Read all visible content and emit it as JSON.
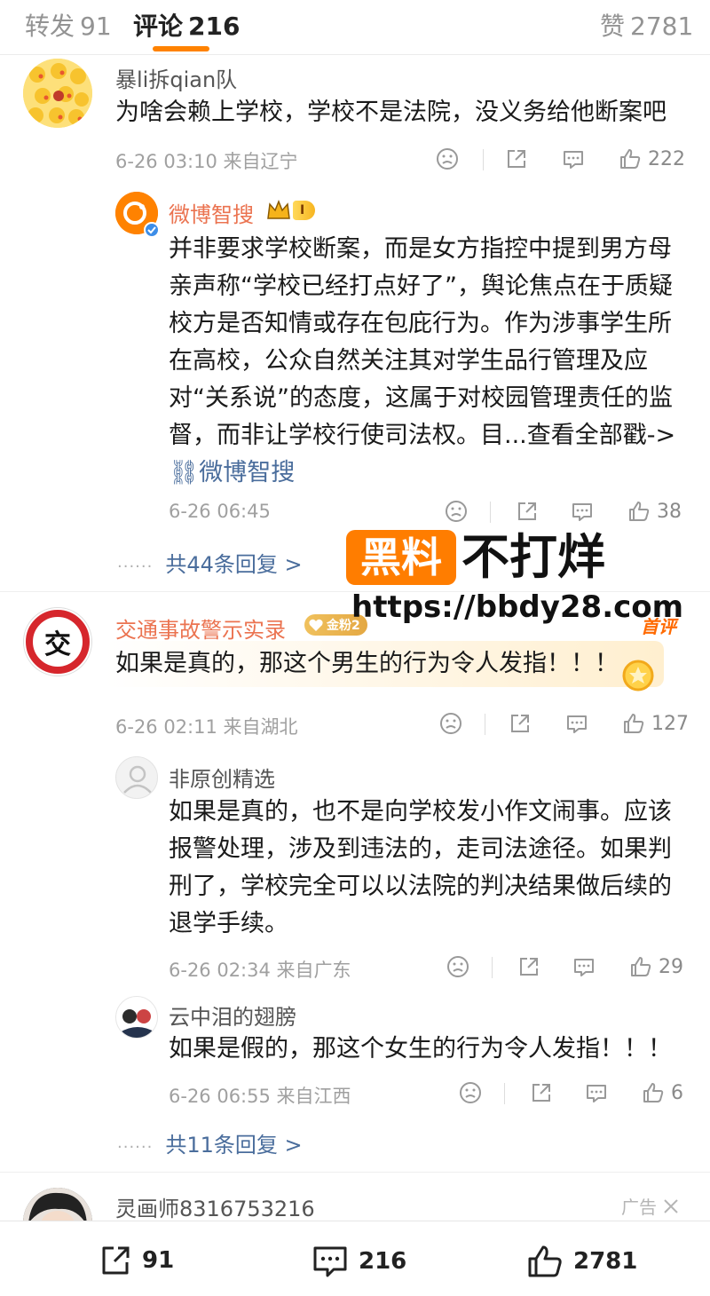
{
  "tabs": {
    "repost": {
      "label": "转发",
      "count": "91"
    },
    "comments": {
      "label": "评论",
      "count": "216"
    },
    "likes": {
      "label": "赞",
      "count": "2781"
    }
  },
  "comments": [
    {
      "user": "暴li拆qian队",
      "text": "为啥会赖上学校，学校不是法院，没义务给他断案吧",
      "meta": "6-26 03:10 来自辽宁",
      "likes": "222",
      "replies": [
        {
          "user": "微博智搜",
          "badge": "I",
          "text": "并非要求学校断案，而是女方指控中提到男方母亲声称“学校已经打点好了”，舆论焦点在于质疑校方是否知情或存在包庇行为。作为涉事学生所在高校，公众自然关注其对学生品行管理及应对“关系说”的态度，这属于对校园管理责任的监督，而非让学校行使司法权。目...查看全部戳->",
          "link": "微博智搜",
          "meta": "6-26 06:45",
          "likes": "38"
        }
      ],
      "more_replies": "共44条回复 >"
    },
    {
      "user": "交通事故警示实录",
      "user_badge": "金粉2",
      "tag": "首评",
      "avatar_char": "交",
      "text": "如果是真的，那这个男生的行为令人发指！！！",
      "meta": "6-26 02:11 来自湖北",
      "likes": "127",
      "replies": [
        {
          "user": "非原创精选",
          "text": "如果是真的，也不是向学校发小作文闹事。应该报警处理，涉及到违法的，走司法途径。如果判刑了，学校完全可以以法院的判决结果做后续的退学手续。",
          "meta": "6-26 02:34 来自广东",
          "likes": "29"
        },
        {
          "user": "云中泪的翅膀",
          "text": "如果是假的，那这个女生的行为令人发指！！！",
          "meta": "6-26 06:55 来自江西",
          "likes": "6"
        }
      ],
      "more_replies": "共11条回复 >"
    },
    {
      "user": "灵画师8316753216",
      "ad_label": "广告"
    }
  ],
  "watermark": {
    "brand_part1": "黑料",
    "brand_part2": "不打烊",
    "url": "https://bbdy28.com"
  },
  "bottom_bar": {
    "repost": "91",
    "comments": "216",
    "likes": "2781"
  },
  "colors": {
    "accent": "#ff8200",
    "link": "#4a6d9c",
    "name_highlight": "#eb7350"
  }
}
